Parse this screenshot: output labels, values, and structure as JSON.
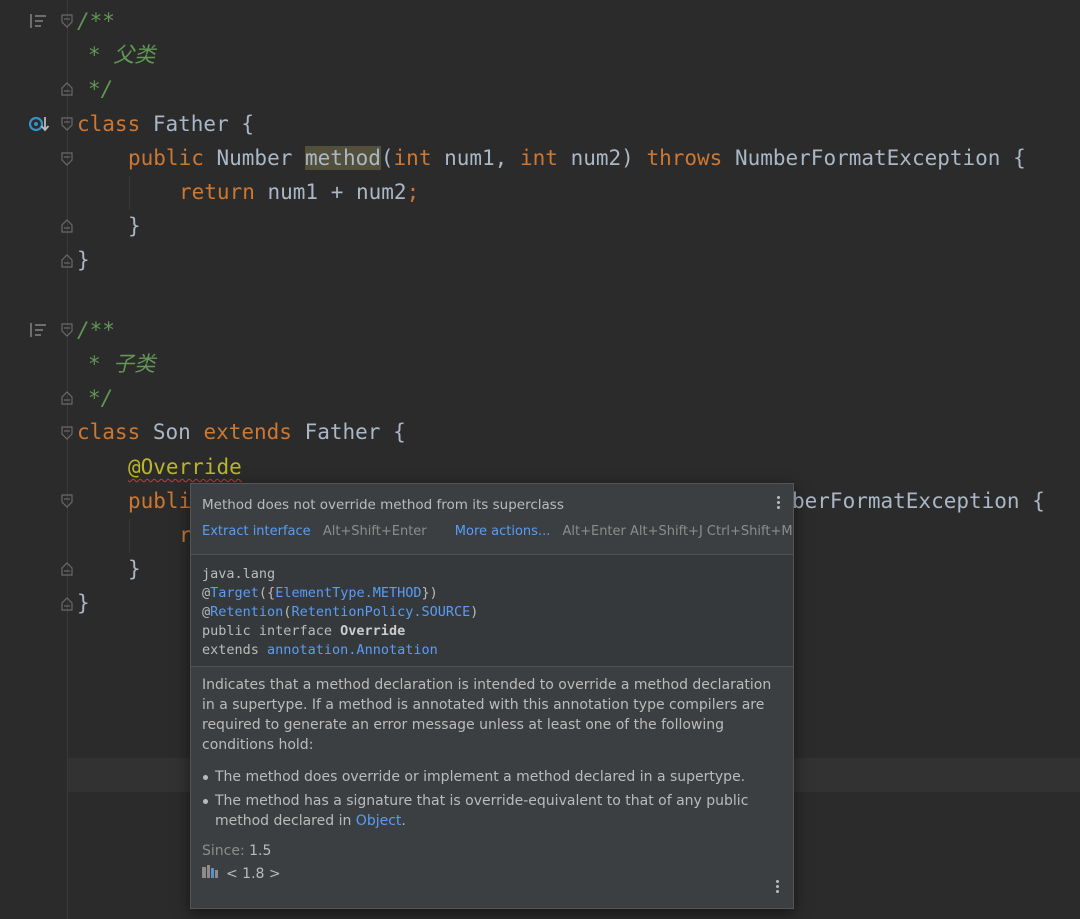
{
  "code": {
    "l1": "/**",
    "l2": "* 父类",
    "l3": "*/",
    "l4_class": "class",
    "l4_name": " Father {",
    "l5_public": "public",
    "l5_type": " Number ",
    "l5_method": "method",
    "l5_p1": "(",
    "l5_int1": "int",
    "l5_num1": " num1, ",
    "l5_int2": "int",
    "l5_num2": " num2) ",
    "l5_throws": "throws",
    "l5_exc": " NumberFormatException {",
    "l6_return": "return",
    "l6_expr": " num1 + num2",
    "l6_semi": ";",
    "l7": "}",
    "l8": "}",
    "l9": "/**",
    "l10": "* 子类",
    "l11": "*/",
    "l12_class": "class",
    "l12_name": " Son ",
    "l12_extends": "extends",
    "l12_father": " Father {",
    "l13": "@Override",
    "l14_public": "publi",
    "l14_rest": "berFormatException {",
    "l15_r": "r",
    "l16": "}",
    "l17": "}"
  },
  "popup": {
    "message": "Method does not override method from its superclass",
    "action1": "Extract interface",
    "action1_shortcut": "Alt+Shift+Enter",
    "action2": "More actions...",
    "action2_shortcut": "Alt+Enter Alt+Shift+J Ctrl+Shift+M",
    "sig_pkg": "java.lang",
    "sig_at1": "@",
    "sig_target": "Target",
    "sig_target_args_open": "({",
    "sig_elementtype": "ElementType.METHOD",
    "sig_target_args_close": "})",
    "sig_at2": "@",
    "sig_retention": "Retention",
    "sig_ret_open": "(",
    "sig_retpolicy": "RetentionPolicy.SOURCE",
    "sig_ret_close": ")",
    "sig_decl_prefix": "public interface ",
    "sig_decl_name": "Override",
    "sig_extends": "extends ",
    "sig_annotation": "annotation.Annotation",
    "description": "Indicates that a method declaration is intended to override a method declaration in a supertype. If a method is annotated with this annotation type compilers are required to generate an error message unless at least one of the following conditions hold:",
    "bullet1": "The method does override or implement a method declared in a supertype.",
    "bullet2_prefix": "The method has a signature that is override-equivalent to that of any public method declared in ",
    "bullet2_link": "Object",
    "bullet2_suffix": ".",
    "since_label": "Since:",
    "since_value": "1.5",
    "library": "< 1.8 >"
  },
  "colors": {
    "background": "#2b2b2b",
    "keyword": "#cc7832",
    "doc_comment": "#629755",
    "annotation": "#bbb529",
    "link": "#589df6",
    "popup_bg": "#3c3f41"
  },
  "icons": [
    "doc-render-icon",
    "fold-icon",
    "overridden-method-icon",
    "library-icon",
    "more-options-icon"
  ]
}
